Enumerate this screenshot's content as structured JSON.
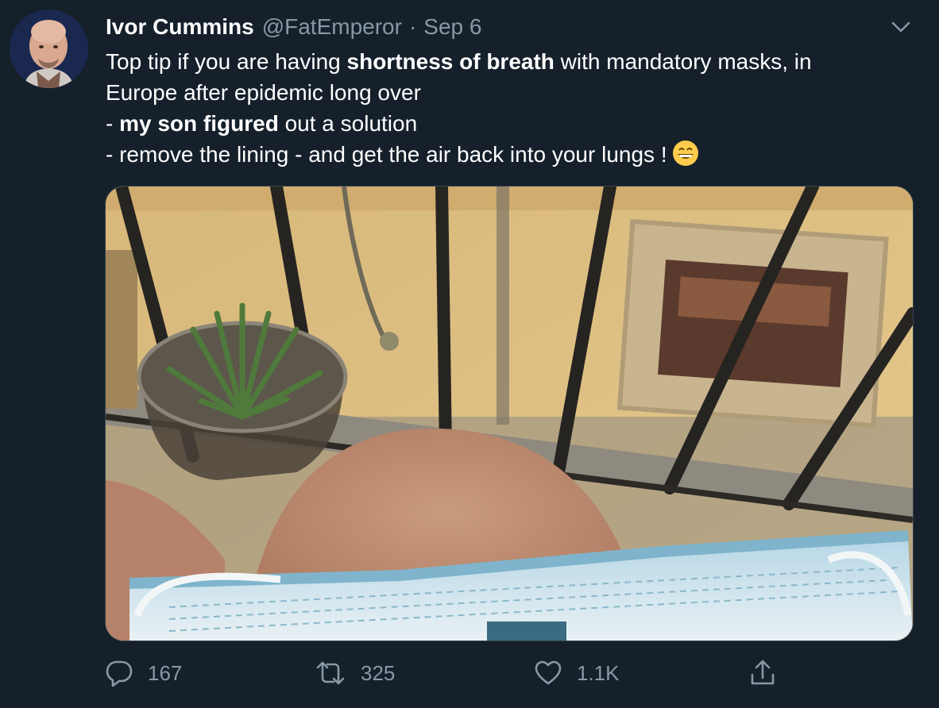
{
  "tweet": {
    "author_name": "Ivor Cummins",
    "handle": "@FatEmperor",
    "separator": "·",
    "date": "Sep 6",
    "text": {
      "l1_a": "Top tip if you are having ",
      "l1_b": "shortness of breath",
      "l1_c": " with mandatory masks, in",
      "l2": "Europe after epidemic long over",
      "l3_a": "- ",
      "l3_b": "my son figured",
      "l3_c": " out a solution",
      "l4": "- remove the lining - and get the air back into your lungs !"
    },
    "emoji": "grinning-face-with-smiling-eyes",
    "media_description_icon": "photo"
  },
  "actions": {
    "reply_count": "167",
    "retweet_count": "325",
    "like_count": "1.1K"
  },
  "colors": {
    "background": "#15202b",
    "text": "#ffffff",
    "secondary": "#8899a6",
    "border": "#38444d"
  },
  "icons": [
    "avatar",
    "chevron-down-icon",
    "reply-icon",
    "retweet-icon",
    "like-icon",
    "share-icon",
    "emoji-icon"
  ]
}
